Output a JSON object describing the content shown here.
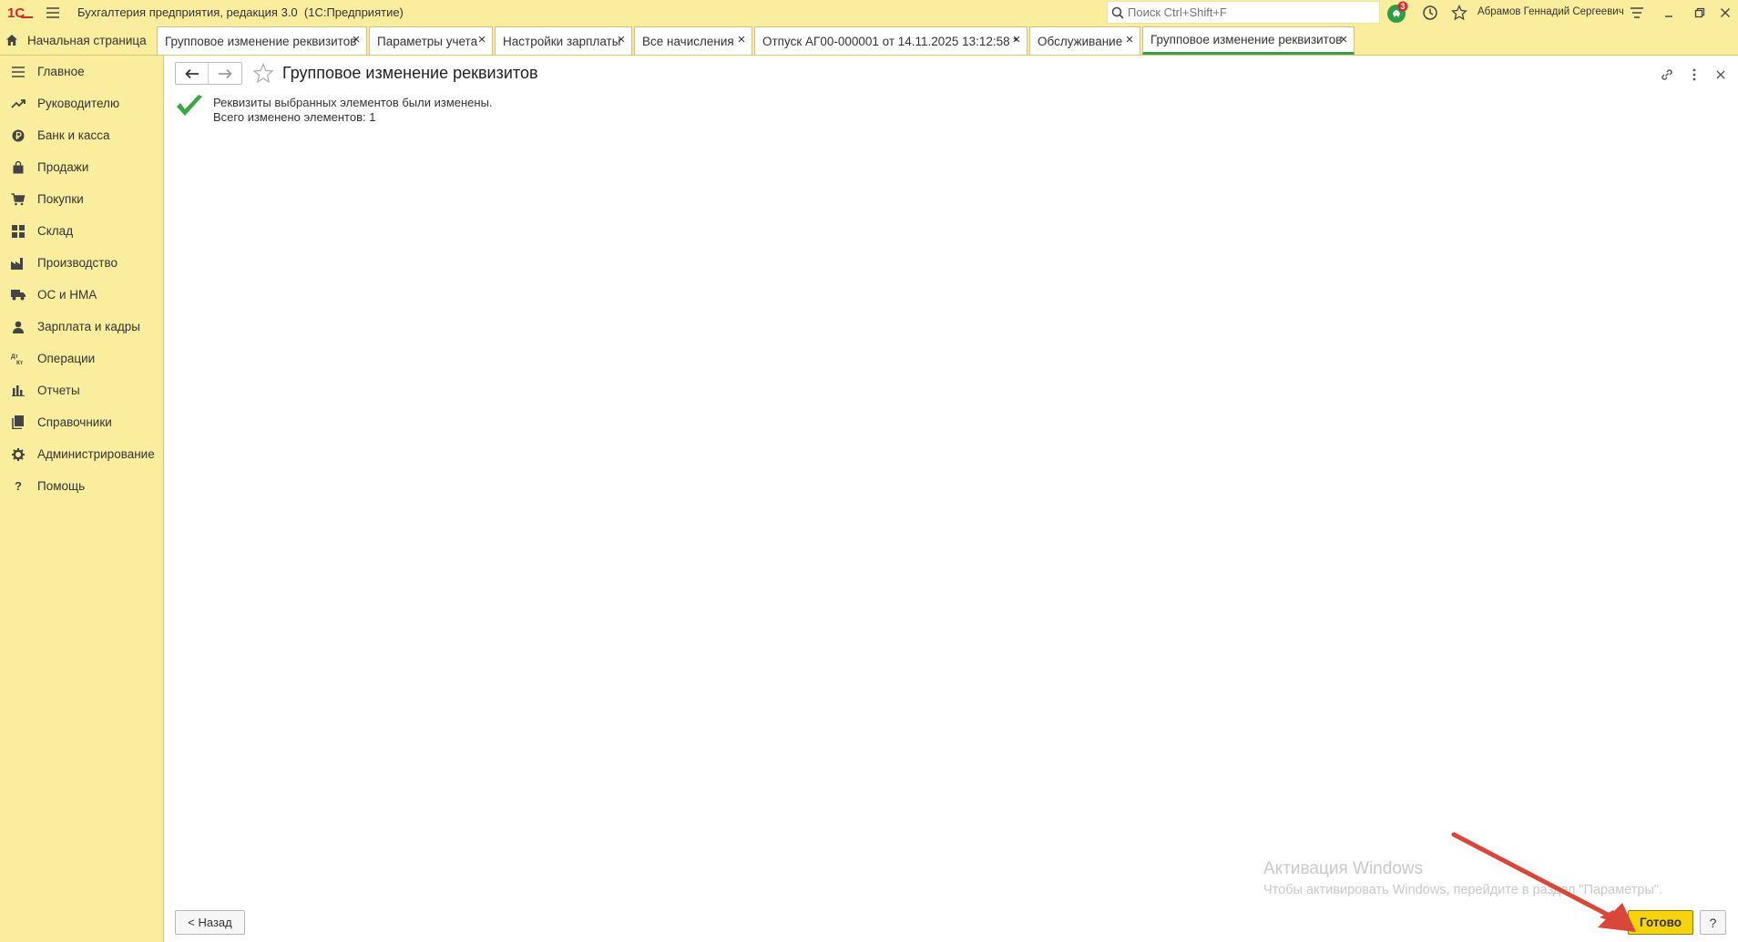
{
  "titlebar": {
    "logo_text": "1С",
    "title": "Бухгалтерия предприятия, редакция 3.0  (1С:Предприятие)",
    "search_placeholder": "Поиск Ctrl+Shift+F",
    "notifications_count": "3",
    "user_name": "Абрамов Геннадий Сергеевич"
  },
  "tabs": {
    "home_label": "Начальная страница",
    "items": [
      {
        "label": "Групповое изменение реквизитов"
      },
      {
        "label": "Параметры учета"
      },
      {
        "label": "Настройки зарплаты"
      },
      {
        "label": "Все начисления"
      },
      {
        "label": "Отпуск АГ00-000001 от 14.11.2025 13:12:58 *"
      },
      {
        "label": "Обслуживание"
      },
      {
        "label": "Групповое изменение реквизитов",
        "active": true
      }
    ]
  },
  "sidebar": {
    "items": [
      {
        "label": "Главное",
        "icon": "menu-icon"
      },
      {
        "label": "Руководителю",
        "icon": "trend-icon"
      },
      {
        "label": "Банк и касса",
        "icon": "ruble-icon"
      },
      {
        "label": "Продажи",
        "icon": "bag-icon"
      },
      {
        "label": "Покупки",
        "icon": "cart-icon"
      },
      {
        "label": "Склад",
        "icon": "warehouse-icon"
      },
      {
        "label": "Производство",
        "icon": "factory-icon"
      },
      {
        "label": "ОС и НМА",
        "icon": "truck-icon"
      },
      {
        "label": "Зарплата и кадры",
        "icon": "person-icon"
      },
      {
        "label": "Операции",
        "icon": "dt-kt-icon"
      },
      {
        "label": "Отчеты",
        "icon": "bar-chart-icon"
      },
      {
        "label": "Справочники",
        "icon": "books-icon"
      },
      {
        "label": "Администрирование",
        "icon": "gear-icon"
      },
      {
        "label": "Помощь",
        "icon": "question-icon"
      }
    ]
  },
  "main": {
    "title": "Групповое изменение реквизитов",
    "message_line1": "Реквизиты выбранных элементов были изменены.",
    "message_line2": "Всего изменено элементов: 1",
    "back_label": "< Назад",
    "done_label": "Готово",
    "help_label": "?"
  },
  "watermark": {
    "line1": "Активация Windows",
    "line2": "Чтобы активировать Windows, перейдите в раздел \"Параметры\"."
  },
  "colors": {
    "panel_yellow": "#fbed9e",
    "active_tab_green": "#3c9e47",
    "done_button_yellow": "#f6d20f",
    "logo_red": "#d6262b",
    "arrow_red": "#d9463a"
  }
}
